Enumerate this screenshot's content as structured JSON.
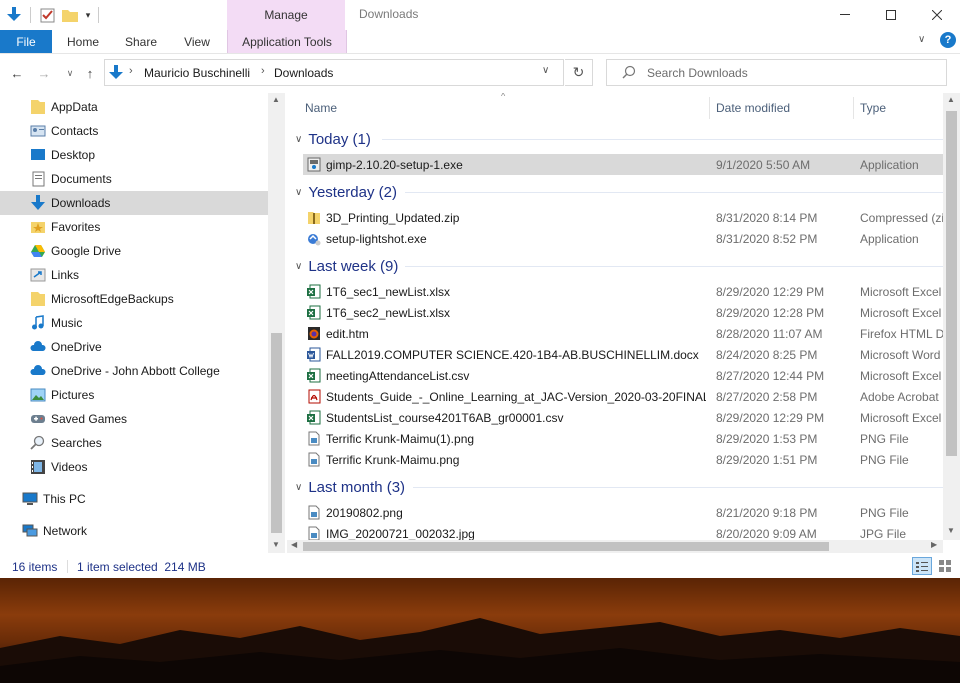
{
  "title": {
    "manage_label": "Manage",
    "window_title": "Downloads"
  },
  "ribbon": {
    "tabs": [
      {
        "label": "File"
      },
      {
        "label": "Home"
      },
      {
        "label": "Share"
      },
      {
        "label": "View"
      },
      {
        "label": "Application Tools"
      }
    ]
  },
  "address": {
    "crumbs": [
      "Mauricio Buschinelli",
      "Downloads"
    ],
    "search_placeholder": "Search Downloads"
  },
  "sidebar": {
    "items": [
      {
        "label": "AppData",
        "icon": "folder-icon"
      },
      {
        "label": "Contacts",
        "icon": "contacts-icon"
      },
      {
        "label": "Desktop",
        "icon": "desktop-icon"
      },
      {
        "label": "Documents",
        "icon": "documents-icon"
      },
      {
        "label": "Downloads",
        "icon": "download-arrow-icon"
      },
      {
        "label": "Favorites",
        "icon": "star-icon"
      },
      {
        "label": "Google Drive",
        "icon": "google-drive-icon"
      },
      {
        "label": "Links",
        "icon": "links-icon"
      },
      {
        "label": "MicrosoftEdgeBackups",
        "icon": "folder-icon"
      },
      {
        "label": "Music",
        "icon": "music-icon"
      },
      {
        "label": "OneDrive",
        "icon": "cloud-icon"
      },
      {
        "label": "OneDrive - John Abbott College",
        "icon": "cloud-icon"
      },
      {
        "label": "Pictures",
        "icon": "pictures-icon"
      },
      {
        "label": "Saved Games",
        "icon": "saved-games-icon"
      },
      {
        "label": "Searches",
        "icon": "search-icon"
      },
      {
        "label": "Videos",
        "icon": "videos-icon"
      },
      {
        "label": "This PC",
        "icon": "pc-icon"
      },
      {
        "label": "Network",
        "icon": "network-icon"
      }
    ]
  },
  "columns": {
    "name": "Name",
    "date": "Date modified",
    "type": "Type"
  },
  "groups": [
    {
      "label": "Today (1)",
      "files": [
        {
          "name": "gimp-2.10.20-setup-1.exe",
          "date": "9/1/2020 5:50 AM",
          "type": "Application",
          "icon": "installer-icon",
          "selected": true
        }
      ]
    },
    {
      "label": "Yesterday (2)",
      "files": [
        {
          "name": "3D_Printing_Updated.zip",
          "date": "8/31/2020 8:14 PM",
          "type": "Compressed (zip",
          "icon": "zip-icon"
        },
        {
          "name": "setup-lightshot.exe",
          "date": "8/31/2020 8:52 PM",
          "type": "Application",
          "icon": "installer-icon"
        }
      ]
    },
    {
      "label": "Last week (9)",
      "files": [
        {
          "name": "1T6_sec1_newList.xlsx",
          "date": "8/29/2020 12:29 PM",
          "type": "Microsoft Excel",
          "icon": "excel-icon"
        },
        {
          "name": "1T6_sec2_newList.xlsx",
          "date": "8/29/2020 12:28 PM",
          "type": "Microsoft Excel",
          "icon": "excel-icon"
        },
        {
          "name": "edit.htm",
          "date": "8/28/2020 11:07 AM",
          "type": "Firefox HTML D",
          "icon": "firefox-icon"
        },
        {
          "name": "FALL2019.COMPUTER SCIENCE.420-1B4-AB.BUSCHINELLIM.docx",
          "date": "8/24/2020 8:25 PM",
          "type": "Microsoft Word",
          "icon": "word-icon"
        },
        {
          "name": "meetingAttendanceList.csv",
          "date": "8/27/2020 12:44 PM",
          "type": "Microsoft Excel",
          "icon": "excel-icon"
        },
        {
          "name": "Students_Guide_-_Online_Learning_at_JAC-Version_2020-03-20FINAL....",
          "date": "8/27/2020 2:58 PM",
          "type": "Adobe Acrobat",
          "icon": "pdf-icon"
        },
        {
          "name": "StudentsList_course4201T6AB_gr00001.csv",
          "date": "8/29/2020 12:29 PM",
          "type": "Microsoft Excel",
          "icon": "excel-icon"
        },
        {
          "name": "Terrific Krunk-Maimu(1).png",
          "date": "8/29/2020 1:53 PM",
          "type": "PNG File",
          "icon": "image-file-icon"
        },
        {
          "name": "Terrific Krunk-Maimu.png",
          "date": "8/29/2020 1:51 PM",
          "type": "PNG File",
          "icon": "image-file-icon"
        }
      ]
    },
    {
      "label": "Last month (3)",
      "files": [
        {
          "name": "20190802.png",
          "date": "8/21/2020 9:18 PM",
          "type": "PNG File",
          "icon": "image-file-icon"
        },
        {
          "name": "IMG_20200721_002032.jpg",
          "date": "8/20/2020 9:09 AM",
          "type": "JPG File",
          "icon": "image-file-icon"
        }
      ]
    }
  ],
  "status": {
    "count": "16 items",
    "selection": "1 item selected  214 MB"
  },
  "colors": {
    "accent": "#1979ca",
    "manage_tab": "#f3dcf5",
    "group_text": "#1e3287"
  }
}
